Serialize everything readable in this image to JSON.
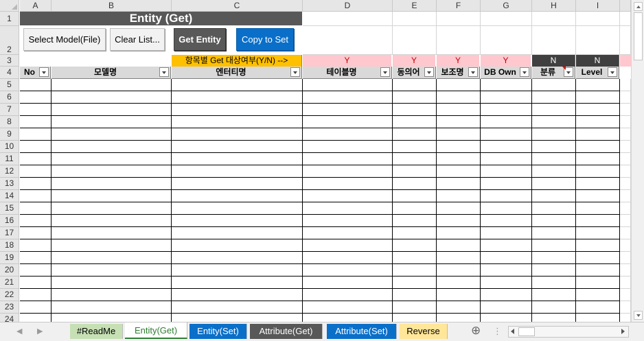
{
  "sheet": {
    "title": "Entity (Get)",
    "columns": [
      "A",
      "B",
      "C",
      "D",
      "E",
      "F",
      "G",
      "H",
      "I"
    ],
    "rows": [
      "1",
      "2",
      "3",
      "4",
      "5",
      "6",
      "7",
      "8",
      "9",
      "10",
      "11",
      "12",
      "13",
      "14",
      "15",
      "16",
      "17",
      "18",
      "19",
      "20",
      "21",
      "22",
      "23",
      "24"
    ],
    "buttons": {
      "select_model": "Select Model(File)",
      "clear_list": "Clear List...",
      "get_entity": "Get Entity",
      "copy_to_set": "Copy to Set"
    },
    "yn_label": "항목별 Get 대상여부(Y/N) -->",
    "flags": [
      "Y",
      "Y",
      "Y",
      "Y",
      "N",
      "N"
    ],
    "headers": [
      "No",
      "모델명",
      "엔터티명",
      "테이블명",
      "동의어",
      "보조명",
      "DB Own",
      "분류",
      "Level"
    ]
  },
  "tabs": [
    {
      "label": "#ReadMe",
      "bg": "#c6e0b4",
      "fg": "#000000"
    },
    {
      "label": "Entity(Get)",
      "bg": "#ffffff",
      "fg": "#2e7d32"
    },
    {
      "label": "Entity(Set)",
      "bg": "#0a6fc9",
      "fg": "#ffffff"
    },
    {
      "label": "Attribute(Get)",
      "bg": "#585858",
      "fg": "#ffffff"
    },
    {
      "label": "Attribute(Set)",
      "bg": "#0a6fc9",
      "fg": "#ffffff"
    },
    {
      "label": "Reverse",
      "bg": "#ffe699",
      "fg": "#000000"
    }
  ],
  "icons": {
    "add_sheet": "⊕",
    "more": "⋮",
    "nav_prev": "◀",
    "nav_next": "▶"
  }
}
